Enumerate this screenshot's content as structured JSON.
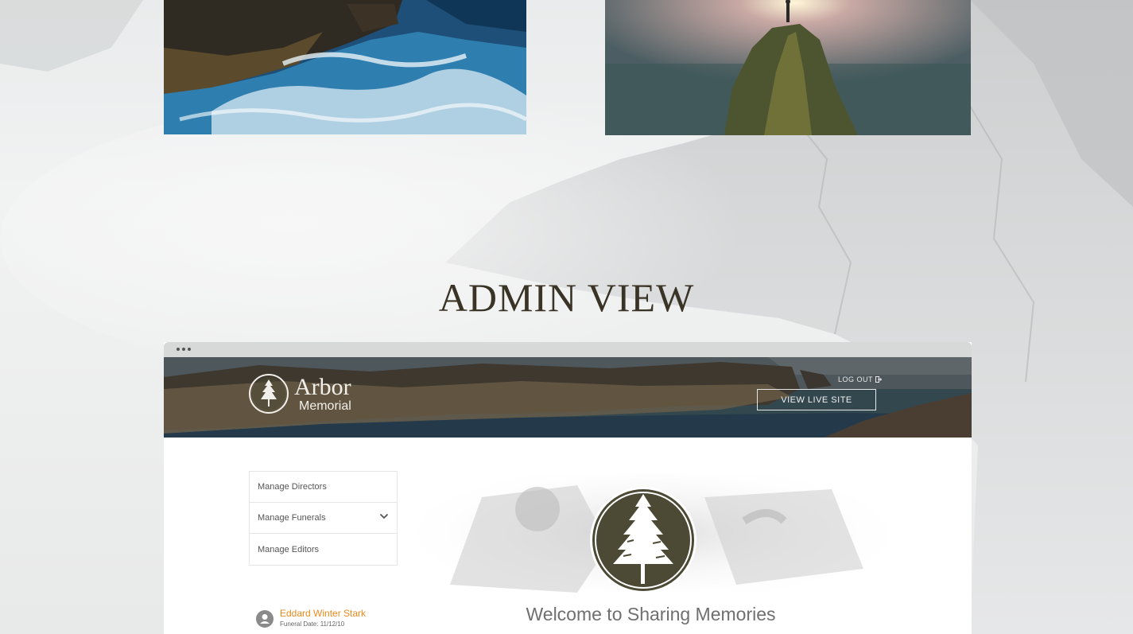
{
  "section_title": "ADMIN VIEW",
  "brand": {
    "name": "Arbor",
    "sub": "Memorial"
  },
  "header": {
    "logout_label": "LOG OUT",
    "view_live_label": "VIEW LIVE SITE"
  },
  "menu": {
    "items": [
      {
        "label": "Manage Directors"
      },
      {
        "label": "Manage Funerals"
      },
      {
        "label": "Manage Editors"
      }
    ]
  },
  "welcome": "Welcome to Sharing Memories",
  "funeral": {
    "name": "Eddard Winter Stark",
    "date": "Funeral Date: 11/12/10"
  },
  "colors": {
    "accent_orange": "#e98a1e",
    "logo_olive": "#4c4a35",
    "title": "#3a3427"
  },
  "icons": [
    "tree-icon",
    "logout-icon",
    "chevron-down-icon",
    "user-icon"
  ]
}
